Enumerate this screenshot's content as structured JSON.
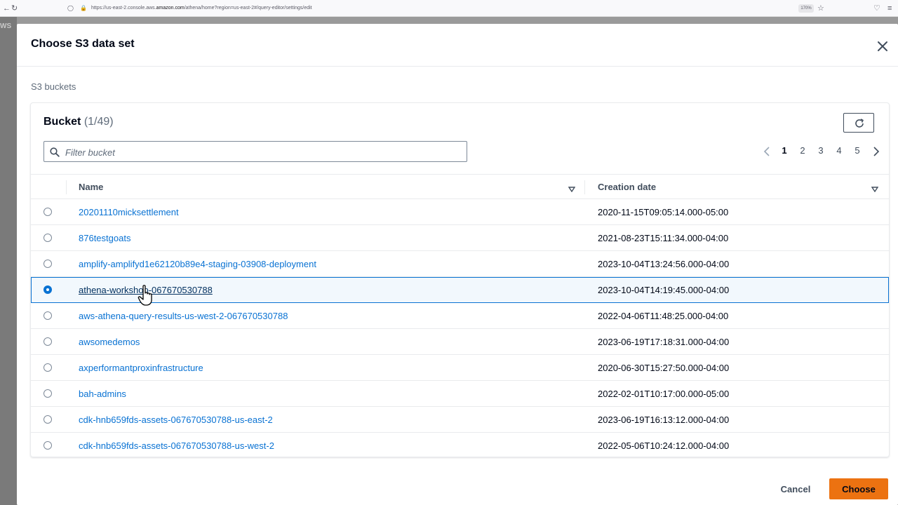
{
  "browser": {
    "url_prefix": "https://us-east-2.console.aws.",
    "url_domain": "amazon.com",
    "url_suffix": "/athena/home?region=us-east-2#/query-editor/settings/edit",
    "zoom": "170%"
  },
  "background": {
    "logo": "WS"
  },
  "modal": {
    "title": "Choose S3 data set",
    "section_label": "S3 buckets",
    "bucket_heading": "Bucket",
    "bucket_count": "(1/49)",
    "filter_placeholder": "Filter bucket",
    "pages": [
      "1",
      "2",
      "3",
      "4",
      "5"
    ],
    "current_page": "1",
    "columns": {
      "name": "Name",
      "creation_date": "Creation date"
    },
    "rows": [
      {
        "name": "20201110micksettlement",
        "date": "2020-11-15T09:05:14.000-05:00",
        "selected": false
      },
      {
        "name": "876testgoats",
        "date": "2021-08-23T15:11:34.000-04:00",
        "selected": false
      },
      {
        "name": "amplify-amplifyd1e62120b89e4-staging-03908-deployment",
        "date": "2023-10-04T13:24:56.000-04:00",
        "selected": false
      },
      {
        "name": "athena-workshop-067670530788",
        "date": "2023-10-04T14:19:45.000-04:00",
        "selected": true
      },
      {
        "name": "aws-athena-query-results-us-west-2-067670530788",
        "date": "2022-04-06T11:48:25.000-04:00",
        "selected": false
      },
      {
        "name": "awsomedemos",
        "date": "2023-06-19T17:18:31.000-04:00",
        "selected": false
      },
      {
        "name": "axperformantproxinfrastructure",
        "date": "2020-06-30T15:27:50.000-04:00",
        "selected": false
      },
      {
        "name": "bah-admins",
        "date": "2022-02-01T10:17:00.000-05:00",
        "selected": false
      },
      {
        "name": "cdk-hnb659fds-assets-067670530788-us-east-2",
        "date": "2023-06-19T16:13:12.000-04:00",
        "selected": false
      },
      {
        "name": "cdk-hnb659fds-assets-067670530788-us-west-2",
        "date": "2022-05-06T10:24:12.000-04:00",
        "selected": false
      }
    ],
    "cancel_label": "Cancel",
    "choose_label": "Choose"
  },
  "colors": {
    "link": "#0972d3",
    "primary_button": "#ec7211",
    "selected_row_bg": "#f2f8fd"
  }
}
